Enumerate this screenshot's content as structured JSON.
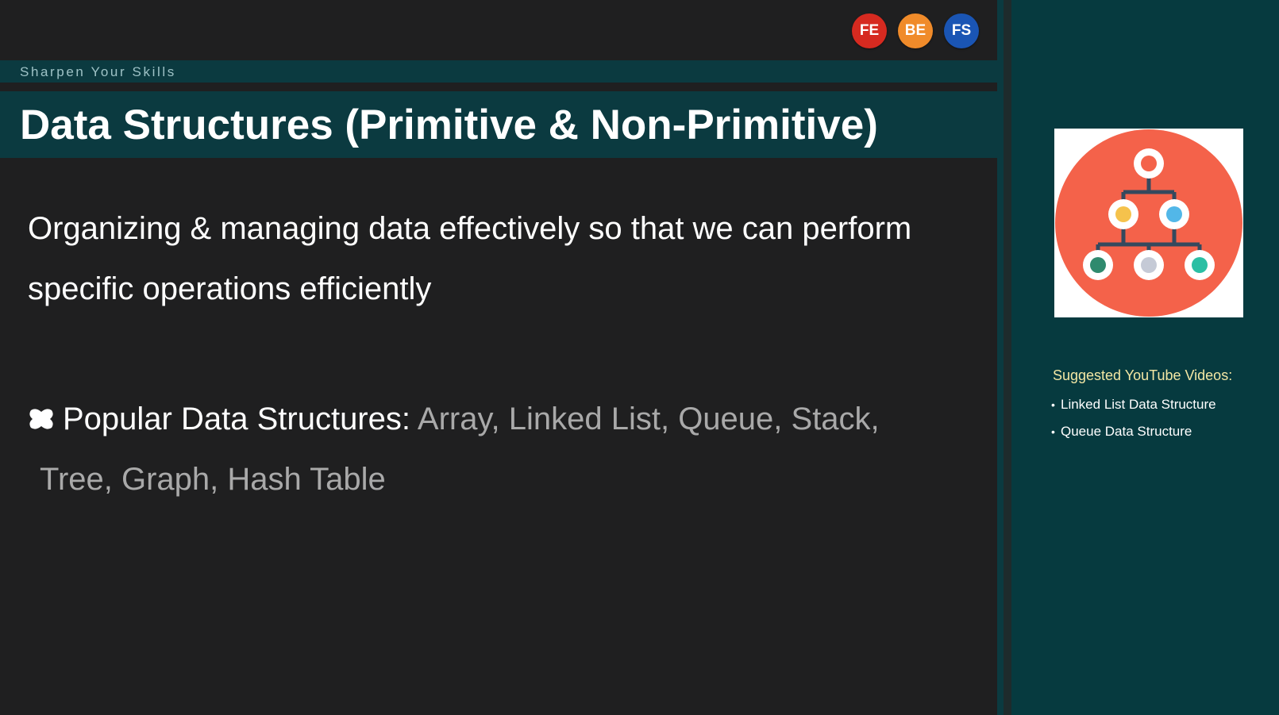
{
  "badges": [
    {
      "label": "FE",
      "color": "#d62a20"
    },
    {
      "label": "BE",
      "color": "#f08b2a"
    },
    {
      "label": "FS",
      "color": "#1a55b4"
    }
  ],
  "strap": {
    "text": "Sharpen Your Skills"
  },
  "slide": {
    "title": "Data Structures (Primitive & Non-Primitive)",
    "definition": "Organizing & managing data effectively so that we can perform specific operations efficiently",
    "popular_label": "Popular Data Structures:",
    "popular_items_line1": "Array, Linked List, Queue, Stack,",
    "popular_items_line2": "Tree, Graph, Hash Table",
    "popular_icon": "bullet-pin-icon"
  },
  "sidebar": {
    "thumbnail_icon": "tree-hierarchy-icon",
    "suggest_title": "Suggested YouTube Videos:",
    "videos": [
      "Linked List Data Structure",
      "Queue Data Structure"
    ]
  },
  "colors": {
    "teal_bar": "#0b3a40",
    "background": "#1f1f20",
    "sidebar": "#063a3f",
    "thumb_circle": "#f4624a",
    "suggest_title": "#f3e7a4",
    "muted_text": "#a9a9a9"
  }
}
